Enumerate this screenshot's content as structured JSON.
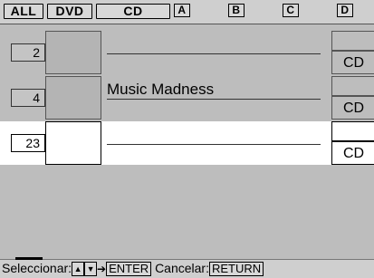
{
  "tabs": [
    {
      "label": "ALL"
    },
    {
      "label": "DVD"
    },
    {
      "label": "CD"
    },
    {
      "label": "A"
    },
    {
      "label": "B"
    },
    {
      "label": "C"
    },
    {
      "label": "D"
    }
  ],
  "rows": [
    {
      "number": "2",
      "title": "",
      "media": "CD",
      "selected": false
    },
    {
      "number": "4",
      "title": "Music Madness",
      "media": "CD",
      "selected": false
    },
    {
      "number": "23",
      "title": "",
      "media": "CD",
      "selected": true
    }
  ],
  "bottom": {
    "select_label": "Seleccionar:",
    "up_icon": "▲",
    "down_icon": "▼",
    "arrow_icon": "➔",
    "enter_label": "ENTER",
    "cancel_label": "Cancelar:",
    "return_label": "RETURN"
  },
  "colors": {
    "background": "#bdbdbd",
    "selected_row": "#ffffff"
  }
}
